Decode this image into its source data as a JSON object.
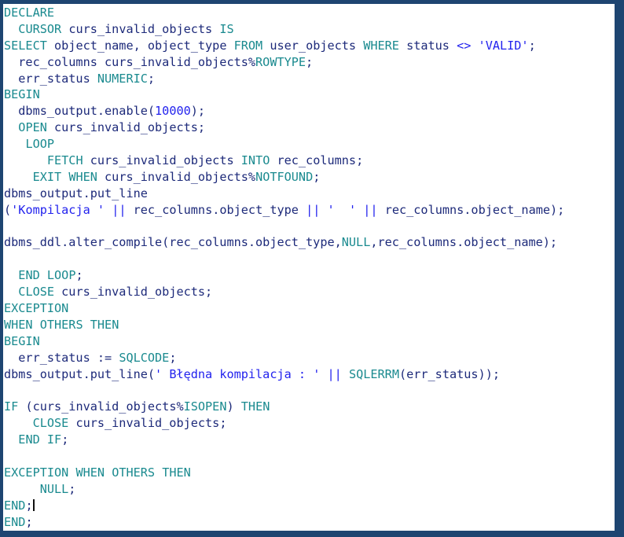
{
  "editor": {
    "title": "PL/SQL code editor",
    "language": "PL/SQL",
    "colors": {
      "border": "#1e4571",
      "background": "#ffffff",
      "keyword": "#1a8a8f",
      "identifier": "#1d2a7a",
      "string": "#2222ee",
      "number": "#2222ee",
      "operator": "#2222ee",
      "caret": "#101010"
    },
    "caret_line": 31,
    "caret_column": 5,
    "lines": [
      {
        "n": 1,
        "text": "DECLARE",
        "tokens": [
          {
            "t": "DECLARE",
            "c": "kw"
          }
        ]
      },
      {
        "n": 2,
        "text": "  CURSOR curs_invalid_objects IS",
        "tokens": [
          {
            "t": "  ",
            "c": "id"
          },
          {
            "t": "CURSOR",
            "c": "kw"
          },
          {
            "t": " curs_invalid_objects ",
            "c": "id"
          },
          {
            "t": "IS",
            "c": "kw"
          }
        ]
      },
      {
        "n": 3,
        "text": "SELECT object_name, object_type FROM user_objects WHERE status <> 'VALID';",
        "tokens": [
          {
            "t": "SELECT",
            "c": "kw"
          },
          {
            "t": " object_name, object_type ",
            "c": "id"
          },
          {
            "t": "FROM",
            "c": "kw"
          },
          {
            "t": " user_objects ",
            "c": "id"
          },
          {
            "t": "WHERE",
            "c": "kw"
          },
          {
            "t": " status ",
            "c": "id"
          },
          {
            "t": "<>",
            "c": "op"
          },
          {
            "t": " ",
            "c": "id"
          },
          {
            "t": "'VALID'",
            "c": "str"
          },
          {
            "t": ";",
            "c": "id"
          }
        ]
      },
      {
        "n": 4,
        "text": "  rec_columns curs_invalid_objects%ROWTYPE;",
        "tokens": [
          {
            "t": "  rec_columns curs_invalid_objects%",
            "c": "id"
          },
          {
            "t": "ROWTYPE",
            "c": "kw"
          },
          {
            "t": ";",
            "c": "id"
          }
        ]
      },
      {
        "n": 5,
        "text": "  err_status NUMERIC;",
        "tokens": [
          {
            "t": "  err_status ",
            "c": "id"
          },
          {
            "t": "NUMERIC",
            "c": "kw"
          },
          {
            "t": ";",
            "c": "id"
          }
        ]
      },
      {
        "n": 6,
        "text": "BEGIN",
        "tokens": [
          {
            "t": "BEGIN",
            "c": "kw"
          }
        ]
      },
      {
        "n": 7,
        "text": "  dbms_output.enable(10000);",
        "tokens": [
          {
            "t": "  dbms_output.enable(",
            "c": "id"
          },
          {
            "t": "10000",
            "c": "num"
          },
          {
            "t": ");",
            "c": "id"
          }
        ]
      },
      {
        "n": 8,
        "text": "  OPEN curs_invalid_objects;",
        "tokens": [
          {
            "t": "  ",
            "c": "id"
          },
          {
            "t": "OPEN",
            "c": "kw"
          },
          {
            "t": " curs_invalid_objects;",
            "c": "id"
          }
        ]
      },
      {
        "n": 9,
        "text": "   LOOP",
        "tokens": [
          {
            "t": "   ",
            "c": "id"
          },
          {
            "t": "LOOP",
            "c": "kw"
          }
        ]
      },
      {
        "n": 10,
        "text": "      FETCH curs_invalid_objects INTO rec_columns;",
        "tokens": [
          {
            "t": "      ",
            "c": "id"
          },
          {
            "t": "FETCH",
            "c": "kw"
          },
          {
            "t": " curs_invalid_objects ",
            "c": "id"
          },
          {
            "t": "INTO",
            "c": "kw"
          },
          {
            "t": " rec_columns;",
            "c": "id"
          }
        ]
      },
      {
        "n": 11,
        "text": "    EXIT WHEN curs_invalid_objects%NOTFOUND;",
        "tokens": [
          {
            "t": "    ",
            "c": "id"
          },
          {
            "t": "EXIT",
            "c": "kw"
          },
          {
            "t": " ",
            "c": "id"
          },
          {
            "t": "WHEN",
            "c": "kw"
          },
          {
            "t": " curs_invalid_objects%",
            "c": "id"
          },
          {
            "t": "NOTFOUND",
            "c": "kw"
          },
          {
            "t": ";",
            "c": "id"
          }
        ]
      },
      {
        "n": 12,
        "text": "dbms_output.put_line",
        "tokens": [
          {
            "t": "dbms_output.put_line",
            "c": "id"
          }
        ]
      },
      {
        "n": 13,
        "text": "('Kompilacja ' || rec_columns.object_type || '  ' || rec_columns.object_name);",
        "tokens": [
          {
            "t": "(",
            "c": "id"
          },
          {
            "t": "'Kompilacja '",
            "c": "str"
          },
          {
            "t": " ",
            "c": "id"
          },
          {
            "t": "||",
            "c": "op"
          },
          {
            "t": " rec_columns.object_type ",
            "c": "id"
          },
          {
            "t": "||",
            "c": "op"
          },
          {
            "t": " ",
            "c": "id"
          },
          {
            "t": "'  '",
            "c": "str"
          },
          {
            "t": " ",
            "c": "id"
          },
          {
            "t": "||",
            "c": "op"
          },
          {
            "t": " rec_columns.object_name);",
            "c": "id"
          }
        ]
      },
      {
        "n": 14,
        "text": "",
        "tokens": []
      },
      {
        "n": 15,
        "text": "dbms_ddl.alter_compile(rec_columns.object_type,NULL,rec_columns.object_name);",
        "tokens": [
          {
            "t": "dbms_ddl.alter_compile(rec_columns.object_type,",
            "c": "id"
          },
          {
            "t": "NULL",
            "c": "kw"
          },
          {
            "t": ",rec_columns.object_name);",
            "c": "id"
          }
        ]
      },
      {
        "n": 16,
        "text": "",
        "tokens": []
      },
      {
        "n": 17,
        "text": "  END LOOP;",
        "tokens": [
          {
            "t": "  ",
            "c": "id"
          },
          {
            "t": "END",
            "c": "kw"
          },
          {
            "t": " ",
            "c": "id"
          },
          {
            "t": "LOOP",
            "c": "kw"
          },
          {
            "t": ";",
            "c": "id"
          }
        ]
      },
      {
        "n": 18,
        "text": "  CLOSE curs_invalid_objects;",
        "tokens": [
          {
            "t": "  ",
            "c": "id"
          },
          {
            "t": "CLOSE",
            "c": "kw"
          },
          {
            "t": " curs_invalid_objects;",
            "c": "id"
          }
        ]
      },
      {
        "n": 19,
        "text": "EXCEPTION",
        "tokens": [
          {
            "t": "EXCEPTION",
            "c": "kw"
          }
        ]
      },
      {
        "n": 20,
        "text": "WHEN OTHERS THEN",
        "tokens": [
          {
            "t": "WHEN",
            "c": "kw"
          },
          {
            "t": " ",
            "c": "id"
          },
          {
            "t": "OTHERS",
            "c": "kw"
          },
          {
            "t": " ",
            "c": "id"
          },
          {
            "t": "THEN",
            "c": "kw"
          }
        ]
      },
      {
        "n": 21,
        "text": "BEGIN",
        "tokens": [
          {
            "t": "BEGIN",
            "c": "kw"
          }
        ]
      },
      {
        "n": 22,
        "text": "  err_status := SQLCODE;",
        "tokens": [
          {
            "t": "  err_status := ",
            "c": "id"
          },
          {
            "t": "SQLCODE",
            "c": "kw"
          },
          {
            "t": ";",
            "c": "id"
          }
        ]
      },
      {
        "n": 23,
        "text": "dbms_output.put_line(' Błędna kompilacja : ' || SQLERRM(err_status));",
        "tokens": [
          {
            "t": "dbms_output.put_line(",
            "c": "id"
          },
          {
            "t": "' Błędna kompilacja : '",
            "c": "str"
          },
          {
            "t": " ",
            "c": "id"
          },
          {
            "t": "||",
            "c": "op"
          },
          {
            "t": " ",
            "c": "id"
          },
          {
            "t": "SQLERRM",
            "c": "kw"
          },
          {
            "t": "(err_status));",
            "c": "id"
          }
        ]
      },
      {
        "n": 24,
        "text": "",
        "tokens": []
      },
      {
        "n": 25,
        "text": "IF (curs_invalid_objects%ISOPEN) THEN",
        "tokens": [
          {
            "t": "IF",
            "c": "kw"
          },
          {
            "t": " (curs_invalid_objects%",
            "c": "id"
          },
          {
            "t": "ISOPEN",
            "c": "kw"
          },
          {
            "t": ") ",
            "c": "id"
          },
          {
            "t": "THEN",
            "c": "kw"
          }
        ]
      },
      {
        "n": 26,
        "text": "    CLOSE curs_invalid_objects;",
        "tokens": [
          {
            "t": "    ",
            "c": "id"
          },
          {
            "t": "CLOSE",
            "c": "kw"
          },
          {
            "t": " curs_invalid_objects;",
            "c": "id"
          }
        ]
      },
      {
        "n": 27,
        "text": "  END IF;",
        "tokens": [
          {
            "t": "  ",
            "c": "id"
          },
          {
            "t": "END",
            "c": "kw"
          },
          {
            "t": " ",
            "c": "id"
          },
          {
            "t": "IF",
            "c": "kw"
          },
          {
            "t": ";",
            "c": "id"
          }
        ]
      },
      {
        "n": 28,
        "text": "",
        "tokens": []
      },
      {
        "n": 29,
        "text": "EXCEPTION WHEN OTHERS THEN",
        "tokens": [
          {
            "t": "EXCEPTION",
            "c": "kw"
          },
          {
            "t": " ",
            "c": "id"
          },
          {
            "t": "WHEN",
            "c": "kw"
          },
          {
            "t": " ",
            "c": "id"
          },
          {
            "t": "OTHERS",
            "c": "kw"
          },
          {
            "t": " ",
            "c": "id"
          },
          {
            "t": "THEN",
            "c": "kw"
          }
        ]
      },
      {
        "n": 30,
        "text": "     NULL;",
        "tokens": [
          {
            "t": "     ",
            "c": "id"
          },
          {
            "t": "NULL",
            "c": "kw"
          },
          {
            "t": ";",
            "c": "id"
          }
        ]
      },
      {
        "n": 31,
        "text": "END;",
        "tokens": [
          {
            "t": "END",
            "c": "kw"
          },
          {
            "t": ";",
            "c": "id"
          }
        ]
      },
      {
        "n": 32,
        "text": "END;",
        "tokens": [
          {
            "t": "END",
            "c": "kw"
          },
          {
            "t": ";",
            "c": "id"
          }
        ]
      }
    ]
  }
}
